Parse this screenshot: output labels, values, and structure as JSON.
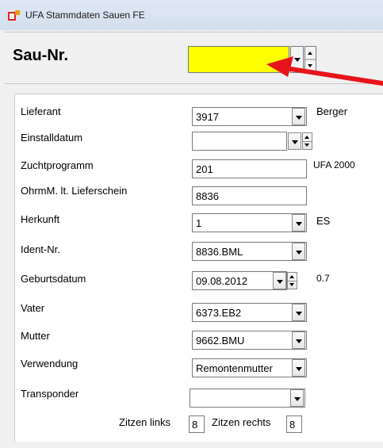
{
  "window": {
    "title": "UFA Stammdaten Sauen FE"
  },
  "header": {
    "sau_label": "Sau-Nr.",
    "sau_value": "",
    "sau_color": "#ffff00"
  },
  "form": {
    "lieferant": {
      "label": "Lieferant",
      "value": "3917",
      "extra": "Berger"
    },
    "einstalldatum": {
      "label": "Einstalldatum",
      "value": ""
    },
    "zuchtprogramm": {
      "label": "Zuchtprogramm",
      "value": "201",
      "extra": "UFA 2000"
    },
    "ohrm": {
      "label": "OhrmM. lt. Lieferschein",
      "value": "8836"
    },
    "herkunft": {
      "label": "Herkunft",
      "value": "1",
      "extra": "ES"
    },
    "ident": {
      "label": "Ident-Nr.",
      "value": "8836.BML"
    },
    "geburtsdatum": {
      "label": "Geburtsdatum",
      "value": "09.08.2012",
      "extra": "0.7"
    },
    "vater": {
      "label": "Vater",
      "value": "6373.EB2"
    },
    "mutter": {
      "label": "Mutter",
      "value": "9662.BMU"
    },
    "verwendung": {
      "label": "Verwendung",
      "value": "Remontenmutter"
    },
    "transponder": {
      "label": "Transponder",
      "value": ""
    },
    "zitzen_links": {
      "label": "Zitzen links",
      "value": "8"
    },
    "zitzen_rechts": {
      "label": "Zitzen rechts",
      "value": "8"
    }
  },
  "annotation": {
    "arrow_color": "#e8141b"
  }
}
